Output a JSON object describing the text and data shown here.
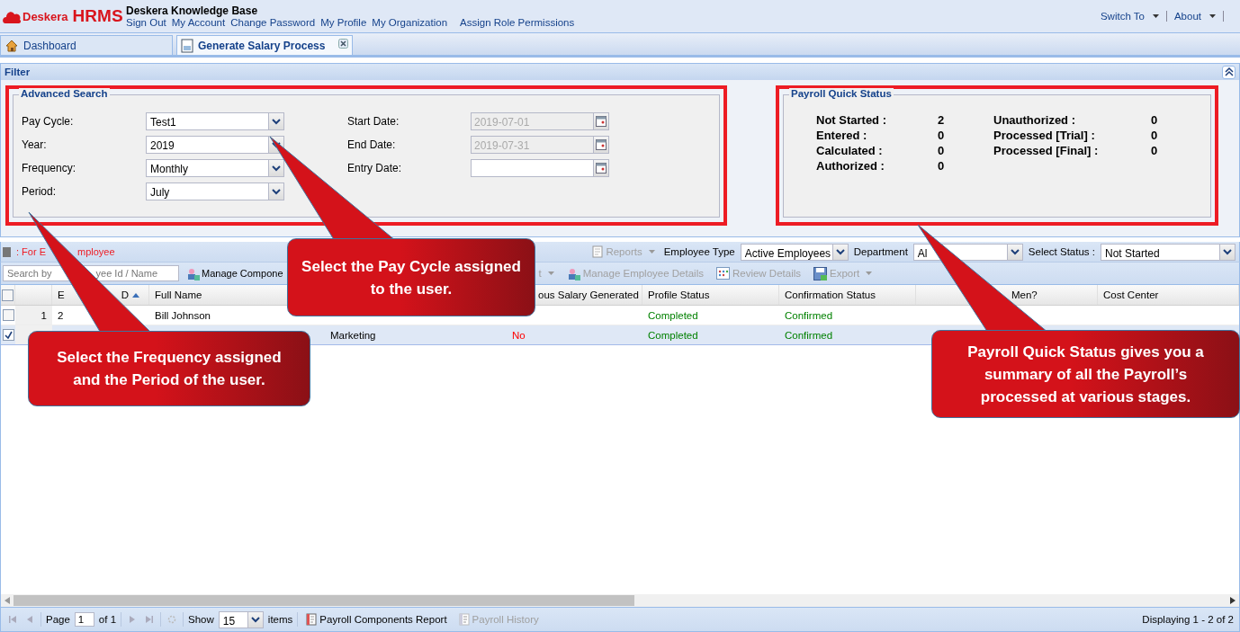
{
  "logo": {
    "brand": "Deskera",
    "product": "HRMS"
  },
  "header": {
    "title": "Deskera Knowledge Base",
    "links": [
      "Sign Out",
      "My Account",
      "Change Password",
      "My Profile",
      "My Organization",
      "Assign Role Permissions"
    ],
    "menus": [
      "Switch To",
      "About"
    ]
  },
  "tabs": [
    {
      "label": "Dashboard",
      "selected": false,
      "closable": false
    },
    {
      "label": "Generate Salary Process",
      "selected": true,
      "closable": true
    }
  ],
  "filter": {
    "title": "Filter",
    "advanced_search": {
      "title": "Advanced Search",
      "left_fields": [
        {
          "label": "Pay Cycle:",
          "value": "Test1"
        },
        {
          "label": "Year:",
          "value": "2019"
        },
        {
          "label": "Frequency:",
          "value": "Monthly"
        },
        {
          "label": "Period:",
          "value": "July"
        }
      ],
      "right_fields": [
        {
          "label": "Start Date:",
          "value": "2019-07-01",
          "disabled": true
        },
        {
          "label": "End Date:",
          "value": "2019-07-31",
          "disabled": true
        },
        {
          "label": "Entry Date:",
          "disabled": false
        }
      ]
    },
    "quick_status": {
      "title": "Payroll Quick Status",
      "left": [
        {
          "label": "Not Started :",
          "value": "2"
        },
        {
          "label": "Entered :",
          "value": "0"
        },
        {
          "label": "Calculated :",
          "value": "0"
        },
        {
          "label": "Authorized :",
          "value": "0"
        }
      ],
      "right": [
        {
          "label": "Unauthorized :",
          "value": "0"
        },
        {
          "label": "Processed [Trial] :",
          "value": "0"
        },
        {
          "label": "Processed [Final] :",
          "value": "0"
        }
      ]
    }
  },
  "grid": {
    "title_parts": [
      ": For E",
      "mployee"
    ],
    "reports": {
      "label": "Reports",
      "disabled": true
    },
    "filters": [
      {
        "label": "Employee Type",
        "value": "Active Employees"
      },
      {
        "label": "Department",
        "value": "Al"
      },
      {
        "label": "Select Status :",
        "value": "Not Started"
      }
    ],
    "search": {
      "placeholder_parts": [
        "Search by",
        "yee Id / Name"
      ]
    },
    "tools": [
      {
        "label": "Manage Compone",
        "disabled": false,
        "menu": false
      },
      {
        "label": "t",
        "disabled": true,
        "menu": true
      },
      {
        "label": "Manage Employee Details",
        "disabled": true,
        "menu": false
      },
      {
        "label": "Review Details",
        "disabled": true,
        "menu": false
      },
      {
        "label": "Export",
        "disabled": true,
        "menu": true
      }
    ],
    "header_checkbox": {
      "checked": false
    },
    "columns": [
      {
        "label_parts": [
          "E",
          "D"
        ],
        "sorted": true
      },
      {
        "label": "Full Name",
        "sorted": false
      },
      {},
      {
        "label": "ous Salary Generated",
        "sorted": false
      },
      {
        "label": "Profile Status",
        "sorted": false
      },
      {
        "label": "Confirmation Status",
        "sorted": false
      },
      {
        "label": "Men?",
        "sorted": false
      },
      {
        "label": "Cost Center",
        "sorted": false
      }
    ],
    "rows": [
      {
        "checked": false,
        "number": "1",
        "cells": [
          {
            "text": "2"
          },
          {
            "text": "Bill Johnson"
          },
          {},
          {},
          {
            "text": "Completed",
            "color": "#008000"
          },
          {
            "text": "Confirmed",
            "color": "#008000"
          },
          {},
          {}
        ]
      },
      {
        "checked": true,
        "cells": [
          {},
          {},
          {
            "text": "Marketing"
          },
          {
            "text": "No",
            "color": "#ff0000"
          },
          {
            "text": "Completed",
            "color": "#008000"
          },
          {
            "text": "Confirmed",
            "color": "#008000"
          },
          {},
          {}
        ]
      }
    ]
  },
  "paging": {
    "page_label": "Page",
    "page": "1",
    "of": "of 1",
    "show_label": "Show",
    "page_size": "15",
    "items_label": "items",
    "reports": [
      {
        "label": "Payroll Components Report",
        "disabled": false
      },
      {
        "label": "Payroll History",
        "disabled": true
      }
    ],
    "summary": "Displaying 1 - 2 of 2"
  },
  "callouts": [
    {
      "text": "Select the Frequency assigned and the Period of the user."
    },
    {
      "text": "Select the Pay Cycle assigned to the user."
    },
    {
      "text": "Payroll Quick Status gives you a summary of all the Payroll’s processed at various stages."
    }
  ]
}
